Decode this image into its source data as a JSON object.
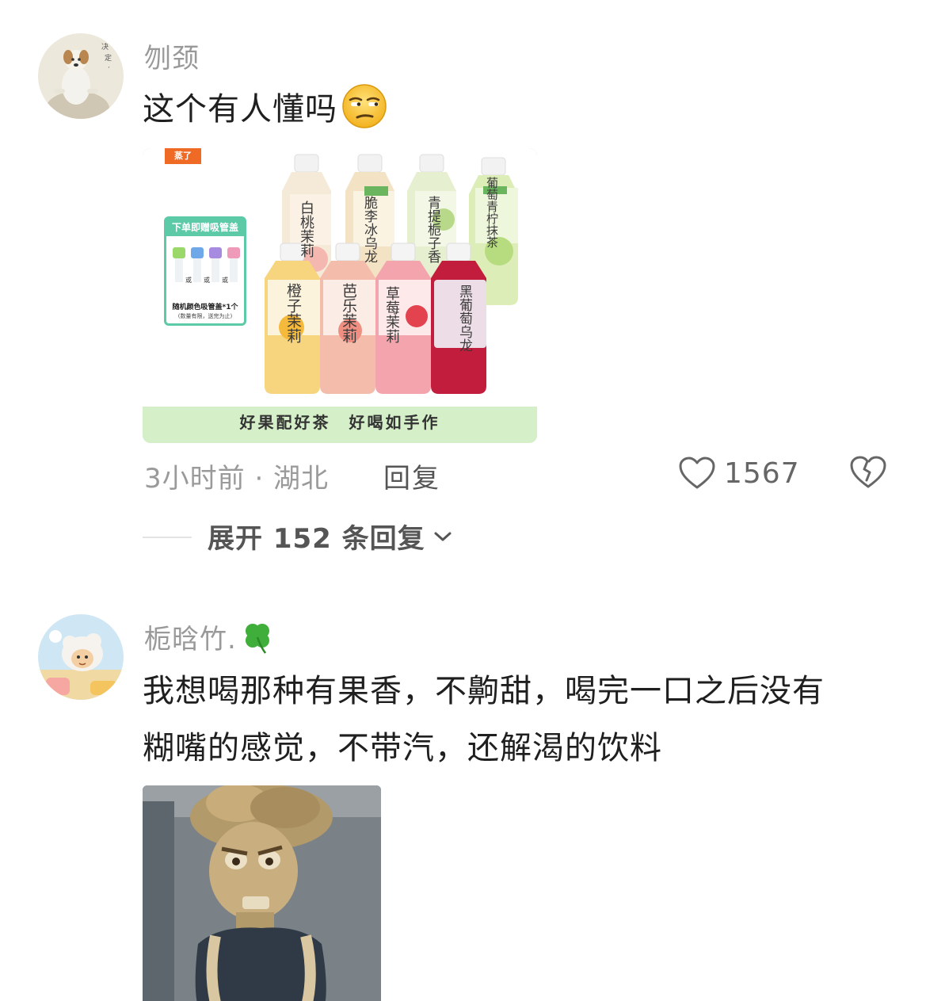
{
  "comments": [
    {
      "username": "刎颈",
      "text": "这个有人懂吗",
      "emoji": "unamused-face-emoji",
      "image": {
        "logo_text": "蒸了",
        "promo_header": "下单即赠吸管盖",
        "promo_or": "或",
        "promo_line1": "随机颜色吸管盖*1个",
        "promo_line2": "(数量有限，送完为止)",
        "bottles": [
          {
            "label": "白桃茉莉",
            "color": "#f5c9c4"
          },
          {
            "label": "脆李冰乌龙",
            "color": "#f0e0c8"
          },
          {
            "label": "青提栀子香",
            "color": "#e5efcf"
          },
          {
            "label": "葡萄青柠抹茶",
            "color": "#d9ecb5"
          },
          {
            "label": "橙子茉莉",
            "color": "#f6cf7a"
          },
          {
            "label": "芭乐茉莉",
            "color": "#f2b5a3"
          },
          {
            "label": "草莓茉莉",
            "color": "#f19aa3"
          },
          {
            "label": "黑葡萄乌龙",
            "color": "#c41e3a"
          }
        ],
        "banner": "好果配好茶　好喝如手作"
      },
      "time_location": "3小时前 · 湖北",
      "reply_label": "回复",
      "like_count": "1567",
      "expand_label": "展开 152 条回复"
    },
    {
      "username": "栀晗竹.",
      "username_icon": "four-leaf-clover-icon",
      "text_lines": [
        "我想喝那种有果香，不齁甜，喝完一口之后没有",
        "糊嘴的感觉，不带汽，还解渴的饮料"
      ]
    }
  ],
  "colors": {
    "username": "#999999",
    "text": "#1f1f1f",
    "meta": "#9a9a9a",
    "accent_green": "#8fdc8a"
  }
}
